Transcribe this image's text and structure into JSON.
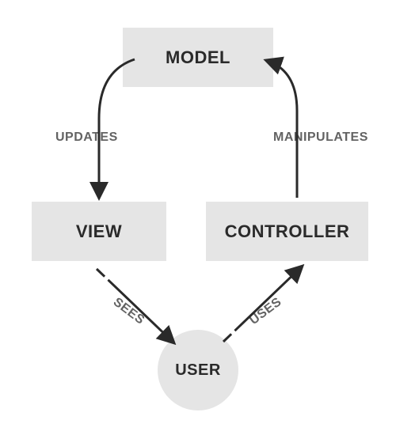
{
  "nodes": {
    "model": "MODEL",
    "view": "VIEW",
    "controller": "CONTROLLER",
    "user": "USER"
  },
  "edges": {
    "model_to_view": "UPDATES",
    "controller_to_model": "MANIPULATES",
    "view_to_user": "SEES",
    "user_to_controller": "USES"
  }
}
